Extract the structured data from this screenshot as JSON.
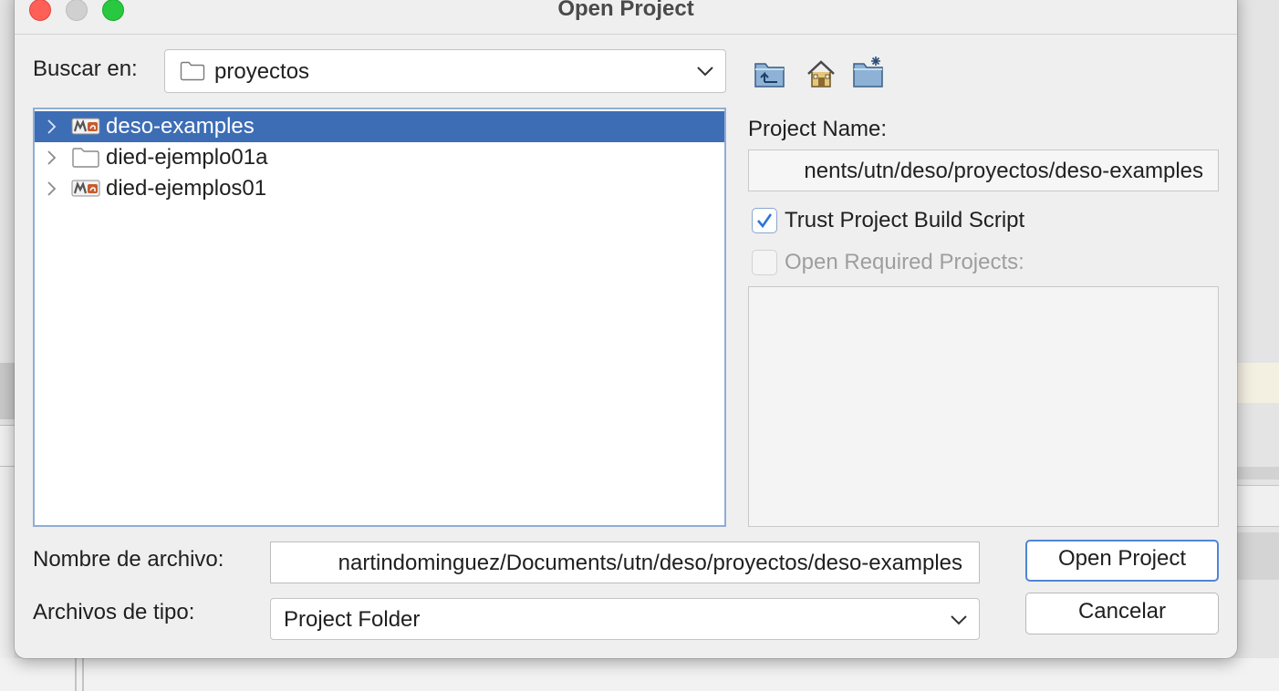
{
  "window": {
    "title": "Open Project"
  },
  "lookin": {
    "label": "Buscar en:",
    "value": "proyectos"
  },
  "toolbar": {
    "icons": [
      "up-folder-icon",
      "home-icon",
      "new-folder-icon"
    ]
  },
  "tree": {
    "items": [
      {
        "label": "deso-examples",
        "icon": "maven-project-icon",
        "selected": true
      },
      {
        "label": "died-ejemplo01a",
        "icon": "folder-icon",
        "selected": false
      },
      {
        "label": "died-ejemplos01",
        "icon": "maven-project-icon",
        "selected": false
      }
    ]
  },
  "project": {
    "name_label": "Project Name:",
    "name_value": "nents/utn/deso/proyectos/deso-examples",
    "trust_label": "Trust Project Build Script",
    "trust_checked": true,
    "required_label": "Open Required Projects:",
    "required_checked": false
  },
  "file": {
    "name_label": "Nombre de archivo:",
    "name_value": "nartindominguez/Documents/utn/deso/proyectos/deso-examples",
    "type_label": "Archivos de tipo:",
    "type_value": "Project Folder"
  },
  "buttons": {
    "open": "Open Project",
    "cancel": "Cancelar"
  },
  "colors": {
    "selection": "#3d6db5",
    "accent": "#4f86d6"
  }
}
